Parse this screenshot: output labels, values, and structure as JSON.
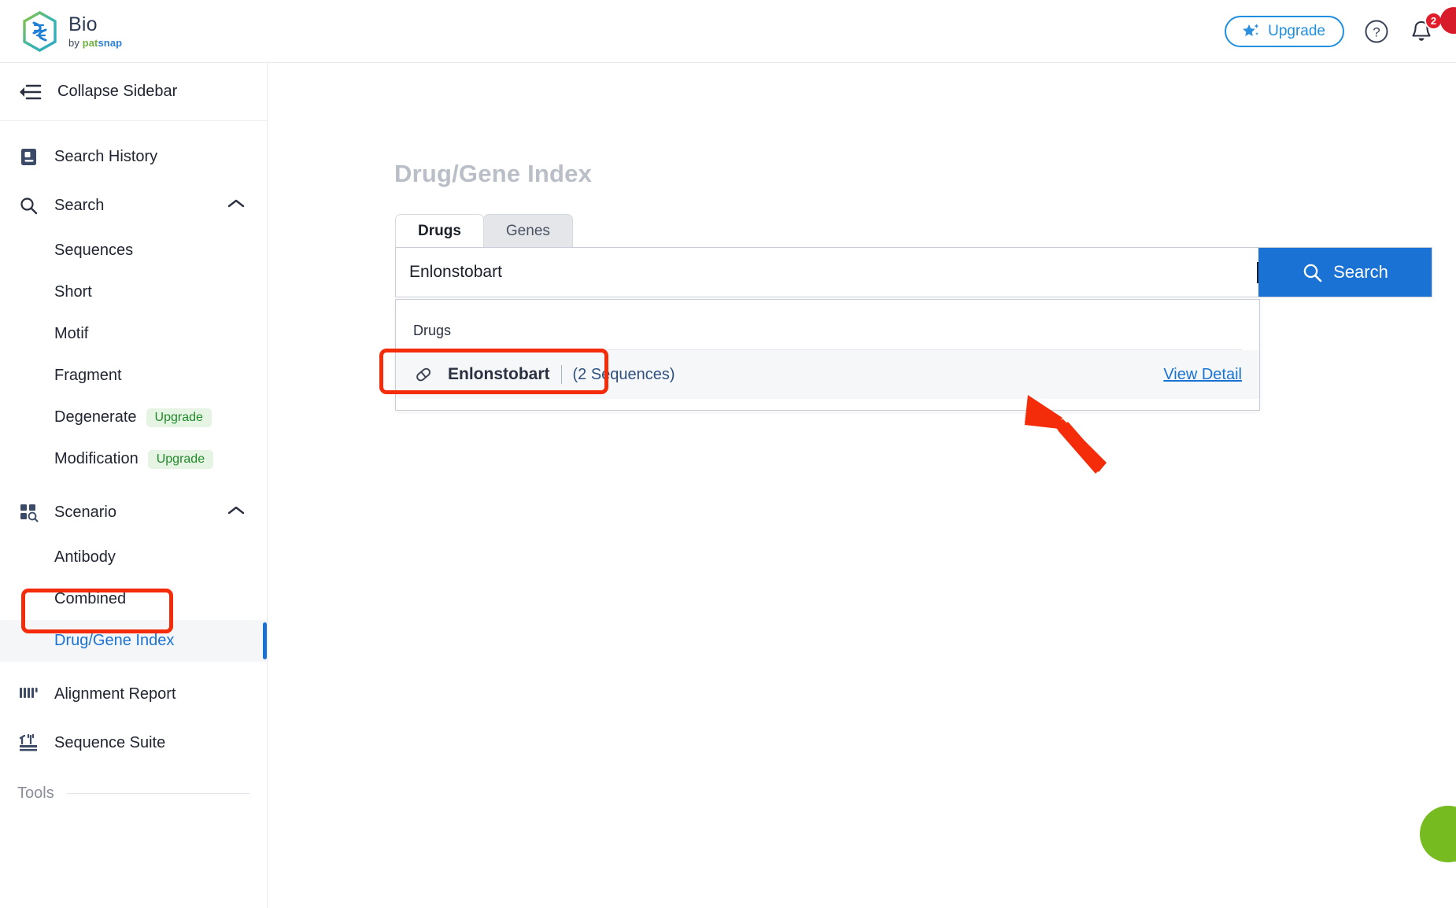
{
  "header": {
    "logo_title": "Bio",
    "logo_sub_by": "by ",
    "logo_sub_pat": "pat",
    "logo_sub_snap": "snap",
    "upgrade_label": "Upgrade",
    "help_icon": "question-circle-icon",
    "bell_icon": "bell-icon",
    "notification_count": "2"
  },
  "sidebar": {
    "collapse_label": "Collapse Sidebar",
    "items": [
      {
        "label": "Search History",
        "icon": "history-doc-icon",
        "type": "item"
      },
      {
        "label": "Search",
        "icon": "magnifier-icon",
        "type": "group",
        "expanded": true,
        "chevron": "chevron-up-icon"
      },
      {
        "label": "Sequences",
        "type": "sub"
      },
      {
        "label": "Short",
        "type": "sub"
      },
      {
        "label": "Motif",
        "type": "sub"
      },
      {
        "label": "Fragment",
        "type": "sub"
      },
      {
        "label": "Degenerate",
        "type": "sub",
        "badge": "Upgrade"
      },
      {
        "label": "Modification",
        "type": "sub",
        "badge": "Upgrade"
      },
      {
        "label": "Scenario",
        "icon": "grid-search-icon",
        "type": "group",
        "expanded": true,
        "chevron": "chevron-up-icon"
      },
      {
        "label": "Antibody",
        "type": "sub"
      },
      {
        "label": "Combined",
        "type": "sub"
      },
      {
        "label": "Drug/Gene Index",
        "type": "sub",
        "active": true
      },
      {
        "label": "Alignment Report",
        "icon": "alignment-bars-icon",
        "type": "item"
      },
      {
        "label": "Sequence Suite",
        "icon": "toolbox-icon",
        "type": "item"
      }
    ],
    "tools_label": "Tools"
  },
  "main": {
    "page_title": "Drug/Gene Index",
    "tabs": [
      {
        "label": "Drugs",
        "active": true
      },
      {
        "label": "Genes",
        "active": false
      }
    ],
    "search": {
      "value": "Enlonstobart",
      "placeholder": "",
      "button_label": "Search",
      "button_icon": "magnifier-icon"
    },
    "dropdown": {
      "section_label": "Drugs",
      "rows": [
        {
          "icon": "pill-capsule-icon",
          "name": "Enlonstobart",
          "count": "(2 Sequences)",
          "link": "View Detail"
        }
      ]
    }
  },
  "annotations": {
    "highlight_sidebar_item": "Drug/Gene Index",
    "highlight_result_name": "Enlonstobart",
    "arrow_points_to": "View Detail",
    "color": "#f52c0a"
  },
  "widgets": {
    "chat_bubble_color": "#76bc21"
  }
}
